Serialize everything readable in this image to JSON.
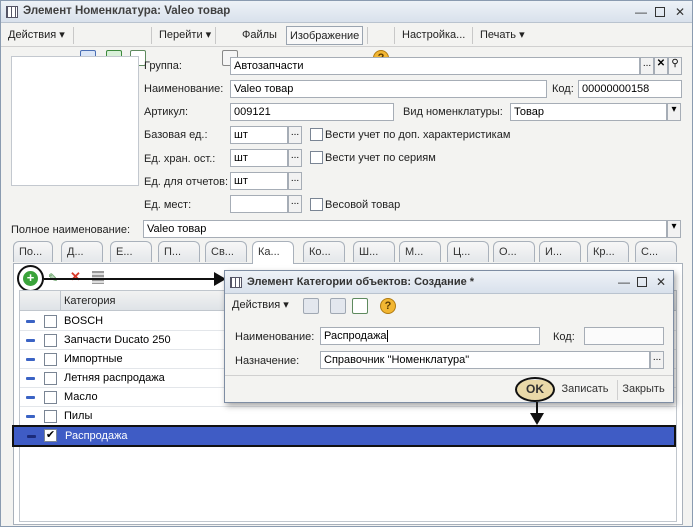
{
  "window": {
    "title": "Элемент Номенклатура: Valeo товар"
  },
  "toolbar": {
    "actions": "Действия",
    "go": "Перейти",
    "files": "Файлы",
    "image": "Изображение",
    "help": "?",
    "settings": "Настройка...",
    "print": "Печать"
  },
  "form": {
    "group_label": "Группа:",
    "group_value": "Автозапчасти",
    "name_label": "Наименование:",
    "name_value": "Valeo товар",
    "code_label": "Код:",
    "code_value": "00000000158",
    "article_label": "Артикул:",
    "article_value": "009121",
    "kind_label": "Вид номенклатуры:",
    "kind_value": "Товар",
    "base_unit_label": "Базовая ед.:",
    "base_unit_value": "шт",
    "extra_chars_label": "Вести учет по доп. характеристикам",
    "storage_unit_label": "Ед. хран. ост.:",
    "storage_unit_value": "шт",
    "series_label": "Вести учет по сериям",
    "report_unit_label": "Ед. для отчетов:",
    "report_unit_value": "шт",
    "place_unit_label": "Ед. мест:",
    "place_unit_value": "",
    "weight_label": "Весовой товар",
    "full_name_label": "Полное наименование:",
    "full_name_value": "Valeo товар"
  },
  "tabs": [
    "По...",
    "Д...",
    "Е...",
    "П...",
    "Св...",
    "Ка...",
    "Ко...",
    "Ш...",
    "М...",
    "Ц...",
    "О...",
    "И...",
    "Кр...",
    "С..."
  ],
  "grid": {
    "header": "Категория",
    "rows": [
      {
        "label": "BOSCH",
        "checked": false
      },
      {
        "label": "Запчасти Ducato 250",
        "checked": false
      },
      {
        "label": "Импортные",
        "checked": false
      },
      {
        "label": "Летняя распродажа",
        "checked": false
      },
      {
        "label": "Масло",
        "checked": false
      },
      {
        "label": "Пилы",
        "checked": false
      },
      {
        "label": "Распродажа",
        "checked": true
      }
    ]
  },
  "dialog": {
    "title": "Элемент Категории объектов: Создание *",
    "actions": "Действия",
    "help": "?",
    "name_label": "Наименование:",
    "name_value": "Распродажа",
    "code_label": "Код:",
    "code_value": "",
    "purpose_label": "Назначение:",
    "purpose_value": "Справочник \"Номенклатура\"",
    "ok": "OK",
    "save": "Записать",
    "close": "Закрыть"
  },
  "colors": {
    "selection": "#3f5cc5",
    "accent_add": "#3aa33a",
    "delete": "#d83a2a"
  }
}
